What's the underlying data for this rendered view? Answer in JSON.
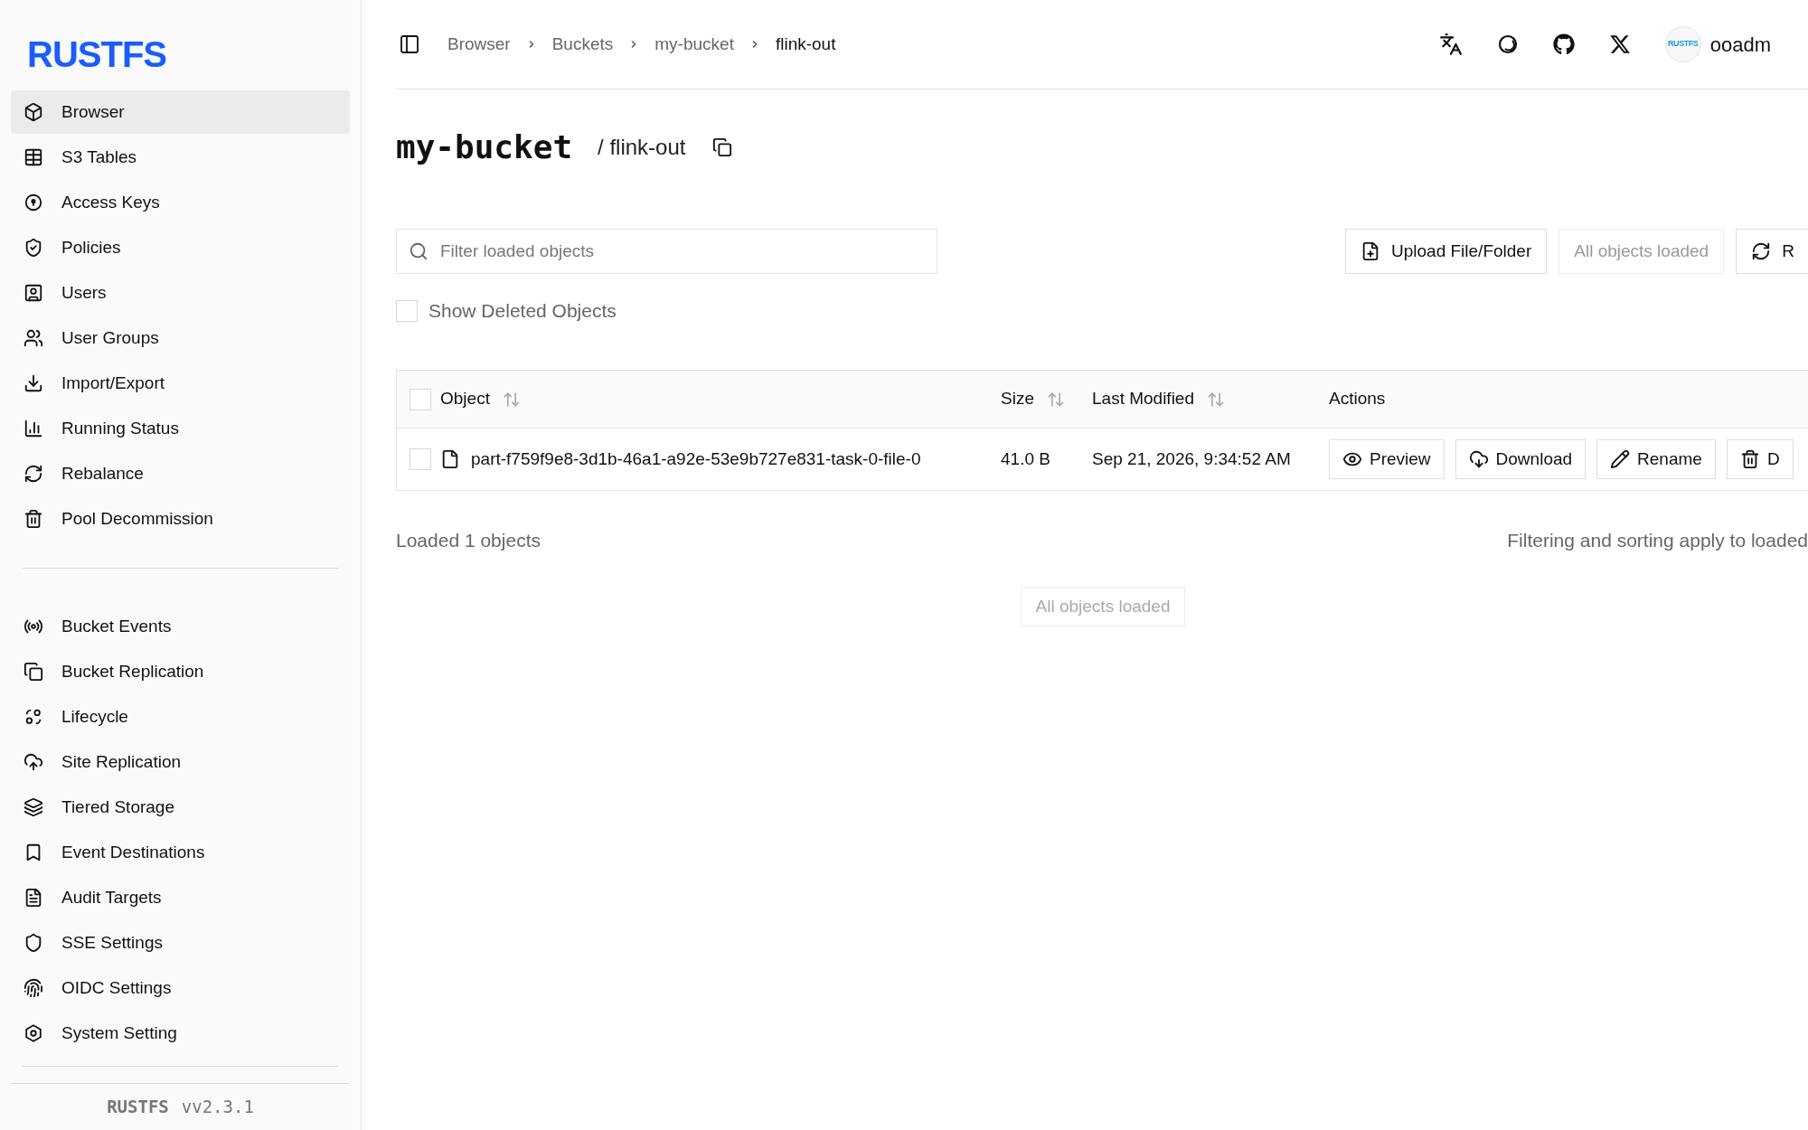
{
  "sidebar": {
    "logo": "RUSTFS",
    "groups": [
      [
        {
          "label": "Browser",
          "selected": true
        },
        {
          "label": "S3 Tables",
          "selected": false
        },
        {
          "label": "Access Keys",
          "selected": false
        },
        {
          "label": "Policies",
          "selected": false
        },
        {
          "label": "Users",
          "selected": false
        },
        {
          "label": "User Groups",
          "selected": false
        },
        {
          "label": "Import/Export",
          "selected": false
        },
        {
          "label": "Running Status",
          "selected": false
        },
        {
          "label": "Rebalance",
          "selected": false
        },
        {
          "label": "Pool Decommission",
          "selected": false
        }
      ],
      [
        {
          "label": "Bucket Events",
          "selected": false
        },
        {
          "label": "Bucket Replication",
          "selected": false
        },
        {
          "label": "Lifecycle",
          "selected": false
        },
        {
          "label": "Site Replication",
          "selected": false
        },
        {
          "label": "Tiered Storage",
          "selected": false
        },
        {
          "label": "Event Destinations",
          "selected": false
        },
        {
          "label": "Audit Targets",
          "selected": false
        },
        {
          "label": "SSE Settings",
          "selected": false
        },
        {
          "label": "OIDC Settings",
          "selected": false
        },
        {
          "label": "System Setting",
          "selected": false
        }
      ]
    ],
    "footer": {
      "brand": "RUSTFS",
      "version": "vv2.3.1"
    }
  },
  "header": {
    "breadcrumbs": [
      {
        "label": "Browser",
        "current": false
      },
      {
        "label": "Buckets",
        "current": false
      },
      {
        "label": "my-bucket",
        "current": false
      },
      {
        "label": "flink-out",
        "current": true
      }
    ],
    "user": {
      "avatar_text": "RUSTFS",
      "name": "ooadm"
    }
  },
  "title": {
    "bucket": "my-bucket",
    "path": "/ flink-out"
  },
  "search": {
    "placeholder": "Filter loaded objects"
  },
  "toolbar": [
    {
      "label": "Upload File/Folder",
      "disabled": false
    },
    {
      "label": "All objects loaded",
      "disabled": true
    },
    {
      "label": "R",
      "disabled": false
    }
  ],
  "show_deleted": {
    "label": "Show Deleted Objects",
    "checked": false
  },
  "table": {
    "all_selected": false,
    "columns": [
      {
        "label": "Object",
        "sortable": true
      },
      {
        "label": "Size",
        "sortable": true
      },
      {
        "label": "Last Modified",
        "sortable": true
      },
      {
        "label": "Actions",
        "sortable": false
      }
    ],
    "rows": [
      {
        "selected": false,
        "name": "part-f759f9e8-3d1b-46a1-a92e-53e9b727e831-task-0-file-0",
        "size": "41.0 B",
        "modified": "Sep 21, 2026, 9:34:52 AM",
        "actions": [
          "Preview",
          "Download",
          "Rename",
          "D"
        ]
      }
    ]
  },
  "footer": {
    "count": "Loaded 1 objects",
    "note": "Filtering and sorting apply to loaded",
    "load_more": {
      "label": "All objects loaded",
      "disabled": true
    }
  }
}
